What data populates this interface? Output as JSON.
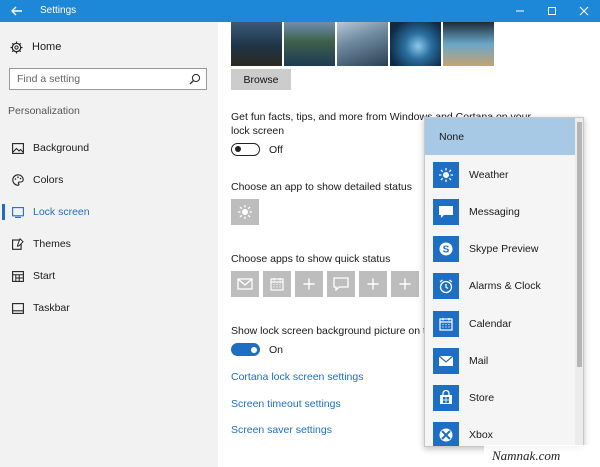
{
  "window": {
    "title": "Settings"
  },
  "sidebar": {
    "home_label": "Home",
    "search_placeholder": "Find a setting",
    "section_label": "Personalization",
    "items": [
      {
        "label": "Background",
        "icon": "image-icon",
        "active": false
      },
      {
        "label": "Colors",
        "icon": "palette-icon",
        "active": false
      },
      {
        "label": "Lock screen",
        "icon": "lock-screen-icon",
        "active": true
      },
      {
        "label": "Themes",
        "icon": "themes-icon",
        "active": false
      },
      {
        "label": "Start",
        "icon": "start-icon",
        "active": false
      },
      {
        "label": "Taskbar",
        "icon": "taskbar-icon",
        "active": false
      }
    ]
  },
  "main": {
    "browse_label": "Browse",
    "fun_facts_text_line1": "Get fun facts, tips, and more from Windows and Cortana on your",
    "fun_facts_text_line2": "lock screen",
    "fun_facts_toggle_label": "Off",
    "detailed_status_label": "Choose an app to show detailed status",
    "quick_status_label": "Choose apps to show quick status",
    "background_on_signin_label": "Show lock screen background picture on the sign-in screen",
    "background_toggle_label": "On",
    "links": {
      "cortana": "Cortana lock screen settings",
      "timeout": "Screen timeout settings",
      "screensaver": "Screen saver settings"
    }
  },
  "dropdown": {
    "items": [
      {
        "label": "None",
        "icon": "",
        "selected": true
      },
      {
        "label": "Weather",
        "icon": "weather-icon",
        "selected": false
      },
      {
        "label": "Messaging",
        "icon": "messaging-icon",
        "selected": false
      },
      {
        "label": "Skype Preview",
        "icon": "skype-icon",
        "selected": false
      },
      {
        "label": "Alarms & Clock",
        "icon": "alarm-clock-icon",
        "selected": false
      },
      {
        "label": "Calendar",
        "icon": "calendar-icon",
        "selected": false
      },
      {
        "label": "Mail",
        "icon": "mail-icon",
        "selected": false
      },
      {
        "label": "Store",
        "icon": "store-icon",
        "selected": false
      },
      {
        "label": "Xbox",
        "icon": "xbox-icon",
        "selected": false
      }
    ]
  },
  "watermark": "Namnak.com",
  "colors": {
    "titlebar": "#1e88d8",
    "accent": "#1e6fc4",
    "sidebar_bg": "#f2f2f2",
    "selected_item": "#a8c9e6"
  }
}
